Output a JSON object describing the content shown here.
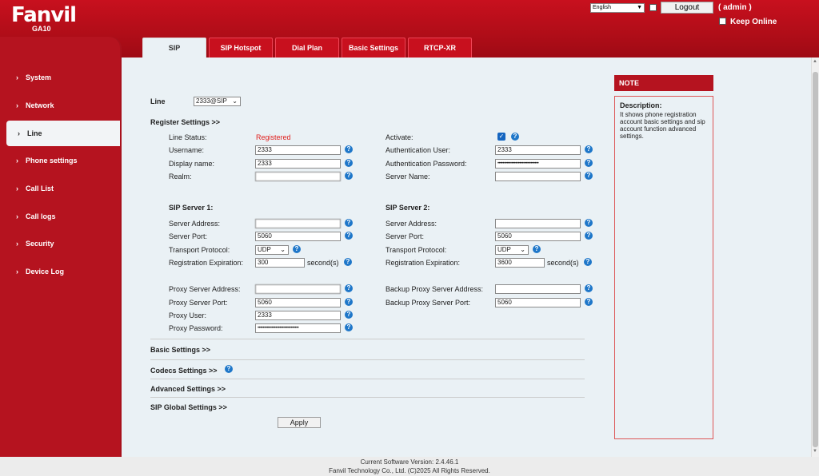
{
  "header": {
    "brand": "Fanvil",
    "model": "GA10",
    "language": "English",
    "logout_label": "Logout",
    "user_label": "( admin )",
    "keep_online_label": "Keep Online"
  },
  "tabs": [
    {
      "label": "SIP",
      "active": true
    },
    {
      "label": "SIP Hotspot",
      "active": false
    },
    {
      "label": "Dial Plan",
      "active": false
    },
    {
      "label": "Basic Settings",
      "active": false
    },
    {
      "label": "RTCP-XR",
      "active": false
    }
  ],
  "sidebar": {
    "items": [
      {
        "label": "System"
      },
      {
        "label": "Network"
      },
      {
        "label": "Line",
        "active": true
      },
      {
        "label": "Phone settings"
      },
      {
        "label": "Call List"
      },
      {
        "label": "Call logs"
      },
      {
        "label": "Security"
      },
      {
        "label": "Device Log"
      }
    ]
  },
  "line": {
    "label": "Line",
    "selected": "2333@SIP"
  },
  "register": {
    "title": "Register Settings >>",
    "line_status_label": "Line Status:",
    "line_status_value": "Registered",
    "activate_label": "Activate:",
    "username_label": "Username:",
    "username_value": "2333",
    "auth_user_label": "Authentication User:",
    "auth_user_value": "2333",
    "display_name_label": "Display name:",
    "display_name_value": "2333",
    "auth_password_label": "Authentication Password:",
    "auth_password_value": "••••••••••••••••••••••••••••••••",
    "realm_label": "Realm:",
    "realm_value": "",
    "server_name_label": "Server Name:",
    "server_name_value": ""
  },
  "server1": {
    "title": "SIP Server 1:",
    "address_label": "Server Address:",
    "address_value": "",
    "port_label": "Server Port:",
    "port_value": "5060",
    "transport_label": "Transport Protocol:",
    "transport_value": "UDP",
    "expiration_label": "Registration Expiration:",
    "expiration_value": "300",
    "unit": "second(s)"
  },
  "server2": {
    "title": "SIP Server 2:",
    "address_label": "Server Address:",
    "address_value": "",
    "port_label": "Server Port:",
    "port_value": "5060",
    "transport_label": "Transport Protocol:",
    "transport_value": "UDP",
    "expiration_label": "Registration Expiration:",
    "expiration_value": "3600",
    "unit": "second(s)"
  },
  "proxy": {
    "address_label": "Proxy Server Address:",
    "address_value": "",
    "port_label": "Proxy Server Port:",
    "port_value": "5060",
    "user_label": "Proxy User:",
    "user_value": "2333",
    "password_label": "Proxy Password:",
    "password_value": "••••••••••••••••••••••••••••••••",
    "backup_address_label": "Backup Proxy Server Address:",
    "backup_address_value": "",
    "backup_port_label": "Backup Proxy Server Port:",
    "backup_port_value": "5060"
  },
  "sections": {
    "basic": "Basic Settings >>",
    "codecs": "Codecs Settings >>",
    "advanced": "Advanced Settings >>",
    "sip_global": "SIP Global Settings >>"
  },
  "apply_label": "Apply",
  "note": {
    "title": "NOTE",
    "desc_title": "Description:",
    "desc_text": "It shows phone registration account basic settings and sip account function advanced settings."
  },
  "footer": {
    "version": "Current Software Version: 2.4.46.1",
    "copyright": "Fanvil Technology Co., Ltd. (C)2025 All Rights Reserved."
  },
  "colors": {
    "brand_red": "#c8101e",
    "status_red": "#e0201e",
    "help_blue": "#1f77c9"
  }
}
